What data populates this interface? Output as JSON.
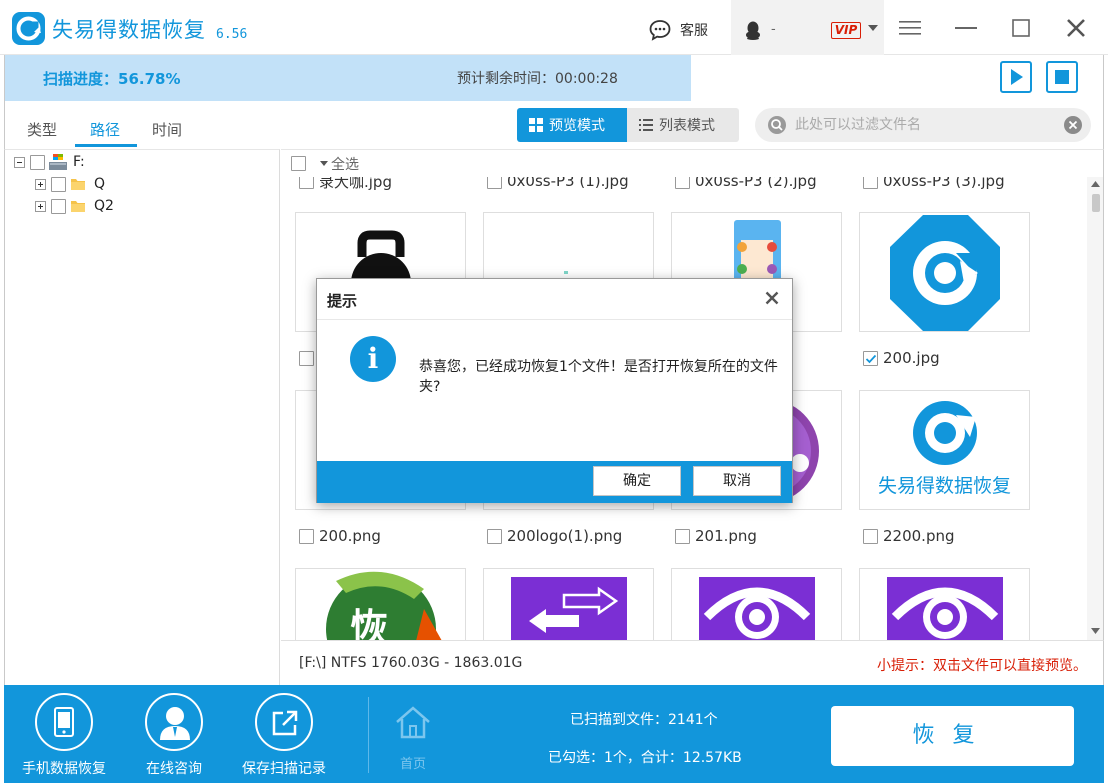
{
  "app": {
    "title": "失易得数据恢复",
    "version": "6.56",
    "support_label": "客服",
    "user_name": "-",
    "vip_label": "VIP",
    "brand_color": "#1296db"
  },
  "scan": {
    "progress_label": "扫描进度：56.78%",
    "progress": 0.5678,
    "remaining_label": "预计剩余时间：00:00:28"
  },
  "tabs": [
    {
      "label": "类型"
    },
    {
      "label": "路径"
    },
    {
      "label": "时间"
    }
  ],
  "modes": {
    "preview": "预览模式",
    "list": "列表模式"
  },
  "filter": {
    "placeholder": "此处可以过滤文件名"
  },
  "tree": {
    "root": "F:",
    "children": [
      "Q",
      "Q2"
    ]
  },
  "grid": {
    "select_all": "全选",
    "top_row": [
      "录大咖.jpg",
      "0x0ss-P3 (1).jpg",
      "0x0ss-P3 (2).jpg",
      "0x0ss-P3 (3).jpg"
    ],
    "row2_labels": [
      "",
      "",
      "",
      "200.jpg"
    ],
    "row3_labels": [
      "200.png",
      "200logo(1).png",
      "201.png",
      "2200.png"
    ],
    "brand_text": "失易得数据恢复",
    "char_tile": "恢"
  },
  "status": {
    "disk_info": "[F:\\] NTFS 1760.03G - 1863.01G",
    "tip": "小提示：双击文件可以直接预览。"
  },
  "bottom": {
    "mobile": "手机数据恢复",
    "consult": "在线咨询",
    "save_record": "保存扫描记录",
    "home": "首页",
    "scanned": "已扫描到文件：2141个",
    "selected": "已勾选：1个，合计：12.57KB",
    "recover": "恢复"
  },
  "dialog": {
    "title": "提示",
    "message": "恭喜您，已经成功恢复1个文件！是否打开恢复所在的文件夹?",
    "ok": "确定",
    "cancel": "取消"
  }
}
